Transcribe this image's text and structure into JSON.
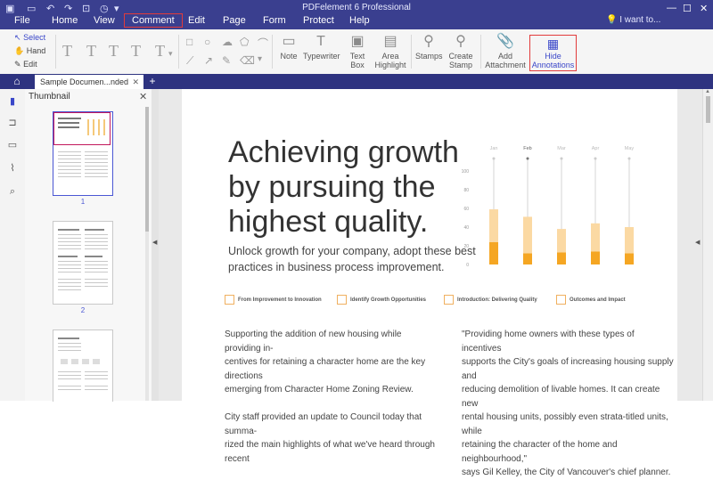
{
  "app": {
    "title": "PDFelement 6 Professional",
    "menus": [
      "File",
      "Home",
      "View",
      "Comment",
      "Edit",
      "Page",
      "Form",
      "Protect",
      "Help"
    ],
    "active_menu": "Comment",
    "i_want_to": "I want to..."
  },
  "ribbon": {
    "select": "Select",
    "hand": "Hand",
    "edit": "Edit",
    "note": "Note",
    "typewriter": "Typewriter",
    "text_box": "Text Box",
    "area_highlight_1": "Area",
    "area_highlight_2": "Highlight",
    "stamps": "Stamps",
    "create_stamp_1": "Create",
    "create_stamp_2": "Stamp",
    "add_attachment_1": "Add",
    "add_attachment_2": "Attachment",
    "hide_annotations_1": "Hide",
    "hide_annotations_2": "Annotations"
  },
  "tabs": {
    "doc_tab": "Sample Documen...nded"
  },
  "thumbnail": {
    "header": "Thumbnail",
    "pages": [
      "1",
      "2"
    ]
  },
  "document": {
    "heading_line1": "Achieving growth",
    "heading_line2": "by pursuing the",
    "heading_line3": "highest quality.",
    "subtitle_line1": "Unlock growth for your company, adopt these best",
    "subtitle_line2": "practices in business process improvement.",
    "categories": [
      "From Improvement to Innovation",
      "Identify Growth Opportunities",
      "Introduction: Delivering Quality",
      "Outcomes and Impact"
    ],
    "col1_lines": [
      "Supporting the addition of new housing while providing in-",
      "centives for retaining a character home are the key directions",
      "emerging from Character Home Zoning Review.",
      "",
      "City staff provided an update to Council today that summa-",
      "rized the main highlights of what we've heard through recent"
    ],
    "col2_lines": [
      "\"Providing home owners with these types of incentives",
      "supports the City's goals of increasing housing supply and",
      "reducing demolition of livable homes.  It can create new",
      "rental housing units, possibly even strata-titled units, while",
      "retaining the character of the home and neighbourhood,\"",
      "says Gil Kelley, the City of Vancouver's chief planner."
    ]
  },
  "chart_data": {
    "type": "bar",
    "categories": [
      "Jan",
      "Feb",
      "Mar",
      "Apr",
      "May"
    ],
    "series": [
      {
        "values": [
          24,
          12,
          13,
          14,
          12
        ]
      },
      {
        "values": [
          35,
          39,
          25,
          30,
          28
        ]
      }
    ],
    "y_ticks": [
      "100",
      "80",
      "60",
      "40",
      "20",
      "0"
    ],
    "ylim": [
      0,
      100
    ],
    "colors": [
      "#f5a623",
      "#fbd9a3"
    ],
    "highlighted_category": "Feb"
  }
}
